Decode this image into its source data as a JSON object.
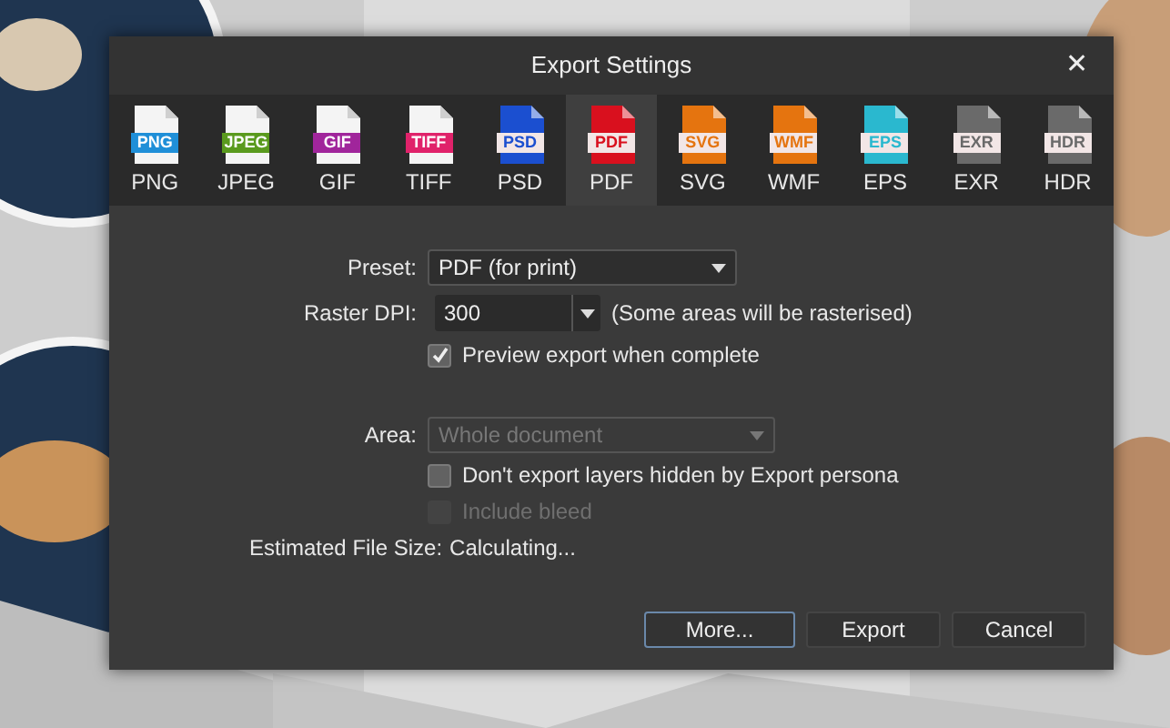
{
  "window": {
    "title": "Export Settings",
    "close": "✕"
  },
  "formats": [
    {
      "icon_label": "PNG",
      "label": "PNG",
      "kind": "white-page",
      "color": "#1f8fd8",
      "selected": false
    },
    {
      "icon_label": "JPEG",
      "label": "JPEG",
      "kind": "white-page",
      "color": "#5a9a1e",
      "selected": false
    },
    {
      "icon_label": "GIF",
      "label": "GIF",
      "kind": "white-page",
      "color": "#a0259b",
      "selected": false
    },
    {
      "icon_label": "TIFF",
      "label": "TIFF",
      "kind": "white-page",
      "color": "#e0226a",
      "selected": false
    },
    {
      "icon_label": "PSD",
      "label": "PSD",
      "kind": "filled-page",
      "color": "#1b4fd0",
      "selected": false
    },
    {
      "icon_label": "PDF",
      "label": "PDF",
      "kind": "filled-page",
      "color": "#d9101e",
      "selected": true
    },
    {
      "icon_label": "SVG",
      "label": "SVG",
      "kind": "filled-page",
      "color": "#e5740f",
      "selected": false
    },
    {
      "icon_label": "WMF",
      "label": "WMF",
      "kind": "filled-page",
      "color": "#e5740f",
      "selected": false
    },
    {
      "icon_label": "EPS",
      "label": "EPS",
      "kind": "filled-page",
      "color": "#2ab8cf",
      "selected": false
    },
    {
      "icon_label": "EXR",
      "label": "EXR",
      "kind": "filled-page",
      "color": "#6a6a6a",
      "selected": false
    },
    {
      "icon_label": "HDR",
      "label": "HDR",
      "kind": "filled-page",
      "color": "#6a6a6a",
      "selected": false
    }
  ],
  "preset": {
    "label": "Preset:",
    "value": "PDF (for print)"
  },
  "raster_dpi": {
    "label": "Raster DPI:",
    "value": "300",
    "note": "(Some areas will be rasterised)"
  },
  "preview_export": {
    "label": "Preview export when complete",
    "checked": true,
    "disabled": false
  },
  "area": {
    "label": "Area:",
    "value": "Whole document",
    "disabled": true
  },
  "options": [
    {
      "label": "Don't export layers hidden by Export persona",
      "checked": false,
      "disabled": false
    },
    {
      "label": "Include bleed",
      "checked": false,
      "disabled": true
    }
  ],
  "estimated_size": {
    "label": "Estimated File Size:",
    "value": "Calculating..."
  },
  "buttons": [
    {
      "label": "More...",
      "selected": true
    },
    {
      "label": "Export",
      "selected": false
    },
    {
      "label": "Cancel",
      "selected": false
    }
  ]
}
